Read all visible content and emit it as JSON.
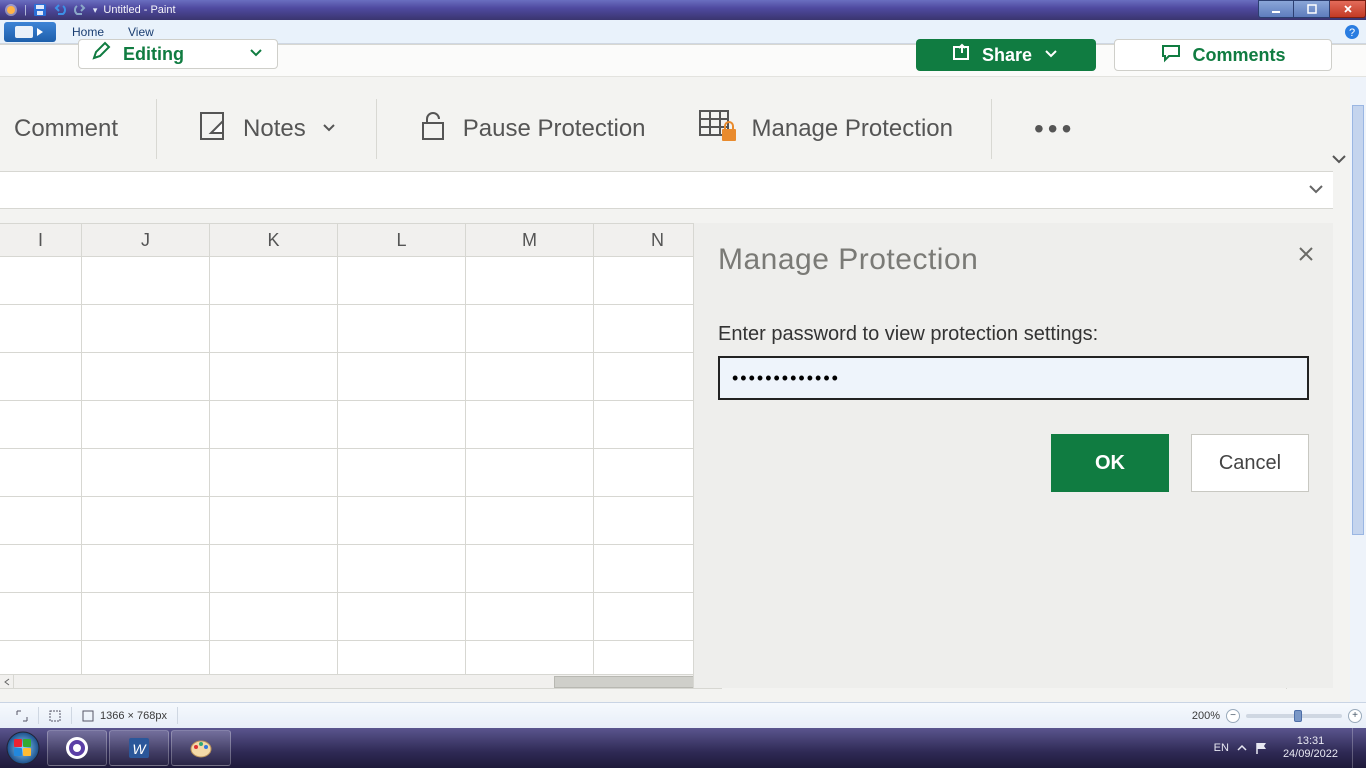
{
  "window": {
    "title": "Untitled - Paint"
  },
  "paint_menu": {
    "home": "Home",
    "view": "View"
  },
  "excel": {
    "editing_label": "Editing",
    "share_label": "Share",
    "comments_label": "Comments",
    "ribbon": {
      "comment": "Comment",
      "notes": "Notes",
      "pause_protection": "Pause Protection",
      "manage_protection": "Manage Protection"
    },
    "columns": [
      "I",
      "J",
      "K",
      "L",
      "M",
      "N"
    ]
  },
  "panel": {
    "title": "Manage Protection",
    "label": "Enter password to view protection settings:",
    "password_value": "•••••••••••••",
    "ok": "OK",
    "cancel": "Cancel"
  },
  "paint_status": {
    "canvas_size": "1366 × 768px",
    "zoom": "200%"
  },
  "tray": {
    "lang": "EN",
    "time": "13:31",
    "date": "24/09/2022"
  }
}
